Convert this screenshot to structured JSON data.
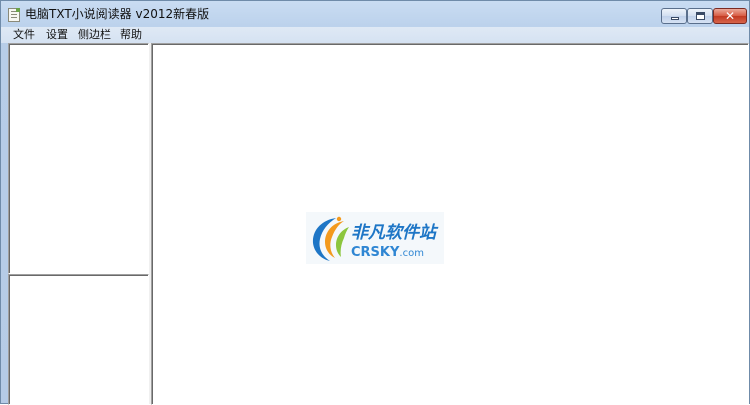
{
  "window": {
    "title": "电脑TXT小说阅读器 v2012新春版",
    "icon": "text-document-icon",
    "controls": {
      "minimize_icon": "minimize-icon",
      "maximize_icon": "maximize-icon",
      "close_icon": "close-icon",
      "close_glyph": "✕"
    }
  },
  "menubar": {
    "items": [
      {
        "label": "文件"
      },
      {
        "label": "设置"
      },
      {
        "label": "侧边栏"
      },
      {
        "label": "帮助"
      }
    ]
  },
  "watermark": {
    "text_cn": "非凡软件站",
    "text_en": "CRSKY",
    "text_domain": ".com",
    "colors": {
      "primary": "#1e76c6",
      "accent_orange": "#f39a1e",
      "accent_green": "#8cc63e"
    }
  }
}
